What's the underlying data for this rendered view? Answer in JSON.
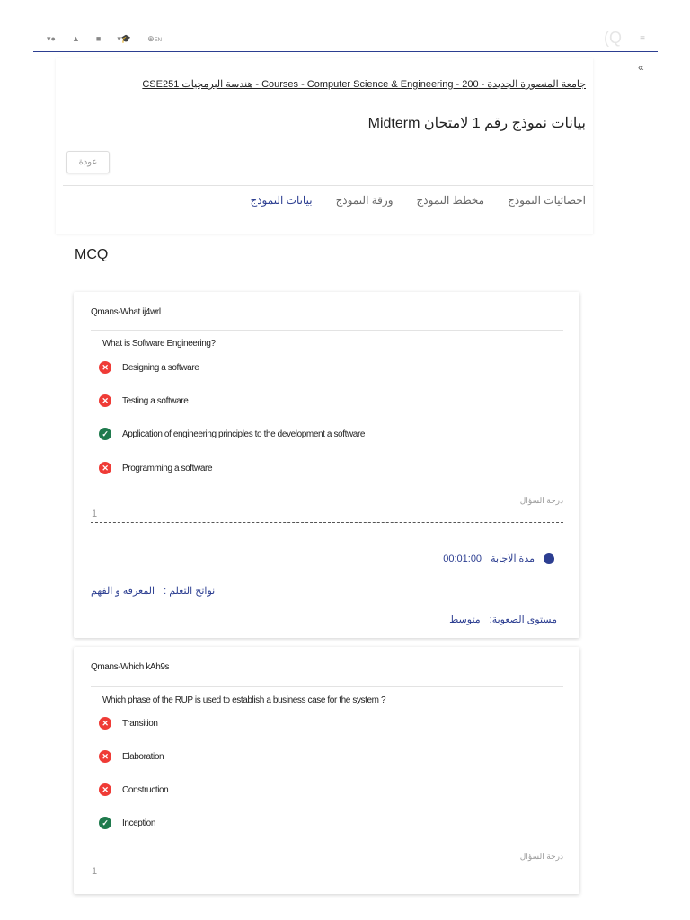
{
  "topbar": {
    "lang": "EN",
    "logo": "Q"
  },
  "breadcrumb": "جامعة المنصورة الجديدة - 200 - Courses - Computer Science & Engineering - هندسة البرمجيات CSE251",
  "page_title": "بيانات نموذج رقم 1 لامتحان Midterm",
  "back_label": "عودة",
  "tabs": [
    "بيانات النموذج",
    "ورقة النموذج",
    "مخطط النموذج",
    "احصائيات النموذج"
  ],
  "section_title": "MCQ",
  "questions": [
    {
      "id": "Qmans-What ij4wrl",
      "text": "What is Software Engineering?",
      "options": [
        {
          "label": "Designing a software",
          "correct": false
        },
        {
          "label": "Testing a software",
          "correct": false
        },
        {
          "label": "Application of engineering principles to the development a software",
          "correct": true
        },
        {
          "label": "Programming a software",
          "correct": false
        }
      ],
      "grade_label": "درجة السؤال",
      "grade": "1",
      "time_label": "مدة الاجابة",
      "time": "00:01:00",
      "outcomes_label": "نواتج التعلم :",
      "outcomes": "المعرفه و الفهم",
      "difficulty_label": "مستوى الصعوبة:",
      "difficulty": "متوسط"
    },
    {
      "id": "Qmans-Which kAh9s",
      "text": "Which phase of the RUP is used to establish a business case for the system ?",
      "options": [
        {
          "label": "Transition",
          "correct": false
        },
        {
          "label": "Elaboration",
          "correct": false
        },
        {
          "label": "Construction",
          "correct": false
        },
        {
          "label": "Inception",
          "correct": true
        }
      ],
      "grade_label": "درجة السؤال",
      "grade": "1"
    }
  ]
}
